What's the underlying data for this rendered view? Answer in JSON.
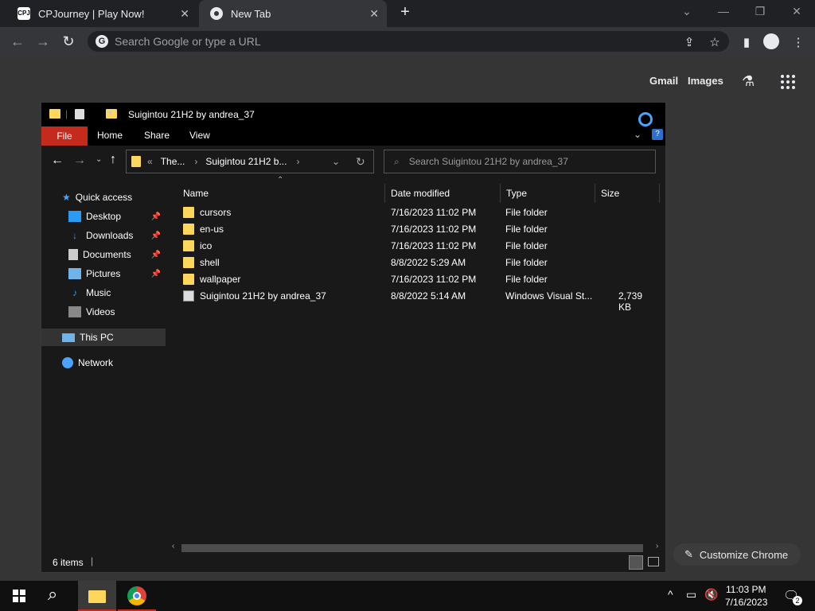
{
  "browser": {
    "tabs": [
      {
        "title": "CPJourney | Play Now!",
        "favicon": "cpj-icon"
      },
      {
        "title": "New Tab",
        "favicon": "chrome-icon"
      }
    ],
    "omnibox_placeholder": "Search Google or type a URL",
    "ntp_links": {
      "gmail": "Gmail",
      "images": "Images"
    },
    "customize_label": "Customize Chrome"
  },
  "explorer": {
    "title": "Suigintou 21H2 by andrea_37",
    "ribbon_tabs": [
      "File",
      "Home",
      "Share",
      "View"
    ],
    "breadcrumb": {
      "prefix": "«",
      "part1": "The...",
      "part2": "Suigintou 21H2 b..."
    },
    "search_placeholder": "Search Suigintou 21H2 by andrea_37",
    "nav": {
      "quick_access": "Quick access",
      "desktop": "Desktop",
      "downloads": "Downloads",
      "documents": "Documents",
      "pictures": "Pictures",
      "music": "Music",
      "videos": "Videos",
      "this_pc": "This PC",
      "network": "Network"
    },
    "columns": {
      "name": "Name",
      "date": "Date modified",
      "type": "Type",
      "size": "Size"
    },
    "files": [
      {
        "name": "cursors",
        "date": "7/16/2023 11:02 PM",
        "type": "File folder",
        "size": ""
      },
      {
        "name": "en-us",
        "date": "7/16/2023 11:02 PM",
        "type": "File folder",
        "size": ""
      },
      {
        "name": "ico",
        "date": "7/16/2023 11:02 PM",
        "type": "File folder",
        "size": ""
      },
      {
        "name": "shell",
        "date": "8/8/2022 5:29 AM",
        "type": "File folder",
        "size": ""
      },
      {
        "name": "wallpaper",
        "date": "7/16/2023 11:02 PM",
        "type": "File folder",
        "size": ""
      },
      {
        "name": "Suigintou 21H2 by andrea_37",
        "date": "8/8/2022 5:14 AM",
        "type": "Windows Visual St...",
        "size": "2,739 KB"
      }
    ],
    "status": "6 items"
  },
  "taskbar": {
    "time": "11:03 PM",
    "date": "7/16/2023",
    "notification_count": "2"
  },
  "colors": {
    "accent": "#c42b1c",
    "folder": "#ffd65c",
    "selection": "#333333"
  }
}
